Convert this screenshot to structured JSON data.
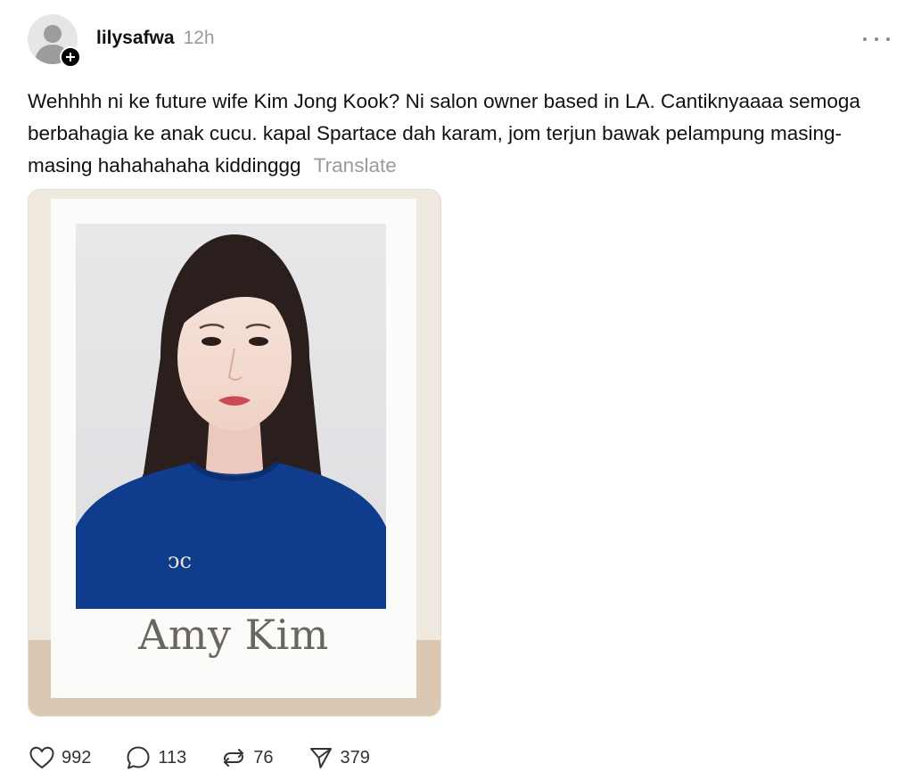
{
  "post": {
    "username": "lilysafwa",
    "timestamp": "12h",
    "caption": "Wehhhh ni ke future wife Kim Jong Kook? Ni salon owner based in LA. Cantiknyaaaa semoga berbahagia ke anak cucu. kapal Spartace dah karam, jom terjun bawak pelampung masing-masing hahahahaha kiddinggg",
    "translate_label": "Translate",
    "image": {
      "name_label": "Amy Kim"
    },
    "actions": {
      "likes": "992",
      "replies": "113",
      "reposts": "76",
      "shares": "379"
    }
  },
  "icons": {
    "avatar": "default-avatar-icon",
    "follow": "plus-icon",
    "more": "more-horizontal-icon",
    "like": "heart-icon",
    "reply": "speech-bubble-icon",
    "repost": "repost-icon",
    "share": "send-icon"
  }
}
